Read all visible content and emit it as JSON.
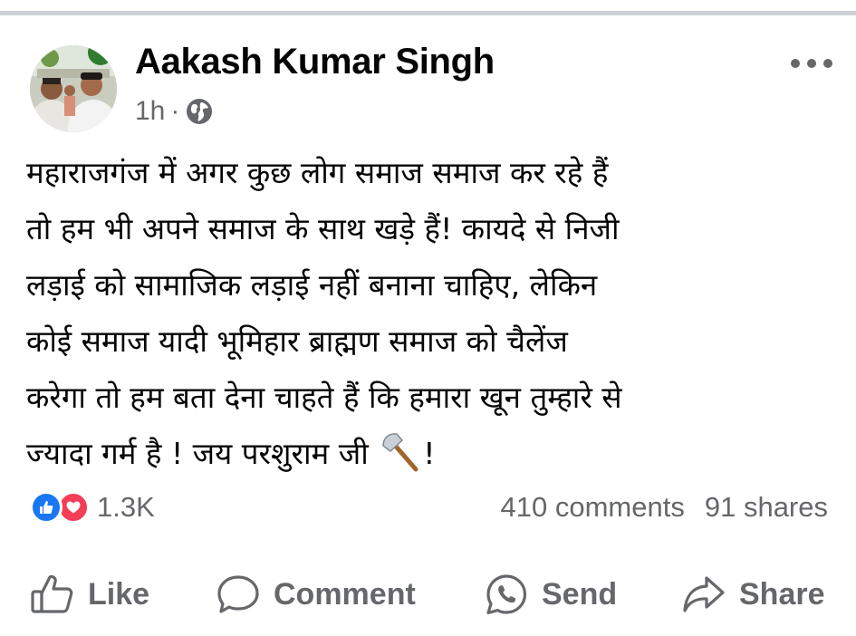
{
  "post": {
    "author_name": "Aakash Kumar Singh",
    "time": "1h",
    "separator": "·",
    "privacy_icon": "globe-icon",
    "menu_icon": "more-dots-icon",
    "text_lines": [
      "महाराजगंज में अगर कुछ लोग समाज समाज कर रहे हैं",
      "तो हम भी अपने समाज के साथ खड़े हैं! कायदे से निजी",
      "लड़ाई को सामाजिक लड़ाई नहीं बनाना चाहिए, लेकिन",
      "कोई समाज यादी भूमिहार ब्राह्मण समाज को चैलेंज",
      "करेगा तो हम बता देना चाहते हैं कि हमारा खून तुम्हारे से",
      "ज्यादा गर्म है ! जय परशुराम जी"
    ],
    "text_end": "!",
    "emoji_icon": "axe-icon"
  },
  "engagement": {
    "reaction_icons": [
      "like-reaction-icon",
      "love-reaction-icon"
    ],
    "reactions_count": "1.3K",
    "comments": "410 comments",
    "shares": "91 shares"
  },
  "actions": {
    "like": "Like",
    "comment": "Comment",
    "send": "Send",
    "share": "Share"
  },
  "colors": {
    "text": "#050505",
    "secondary_text": "#65676b",
    "like_blue": "#1877f2",
    "love_red": "#f33e58",
    "divider": "#cdd0d5"
  }
}
